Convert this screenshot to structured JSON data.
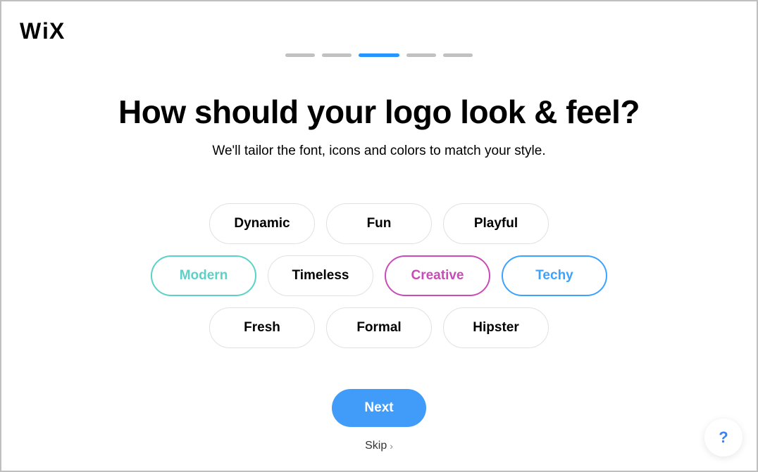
{
  "brand": "WiX",
  "progress": {
    "total": 5,
    "current": 3
  },
  "title": "How should your logo look & feel?",
  "subtitle": "We'll tailor the font, icons and colors to match your style.",
  "chips": {
    "row1": [
      {
        "label": "Dynamic",
        "style": "default"
      },
      {
        "label": "Fun",
        "style": "default"
      },
      {
        "label": "Playful",
        "style": "default"
      }
    ],
    "row2": [
      {
        "label": "Modern",
        "style": "modern"
      },
      {
        "label": "Timeless",
        "style": "default"
      },
      {
        "label": "Creative",
        "style": "creative"
      },
      {
        "label": "Techy",
        "style": "techy"
      }
    ],
    "row3": [
      {
        "label": "Fresh",
        "style": "default"
      },
      {
        "label": "Formal",
        "style": "default"
      },
      {
        "label": "Hipster",
        "style": "default"
      }
    ]
  },
  "actions": {
    "next": "Next",
    "skip": "Skip"
  },
  "help": "?"
}
